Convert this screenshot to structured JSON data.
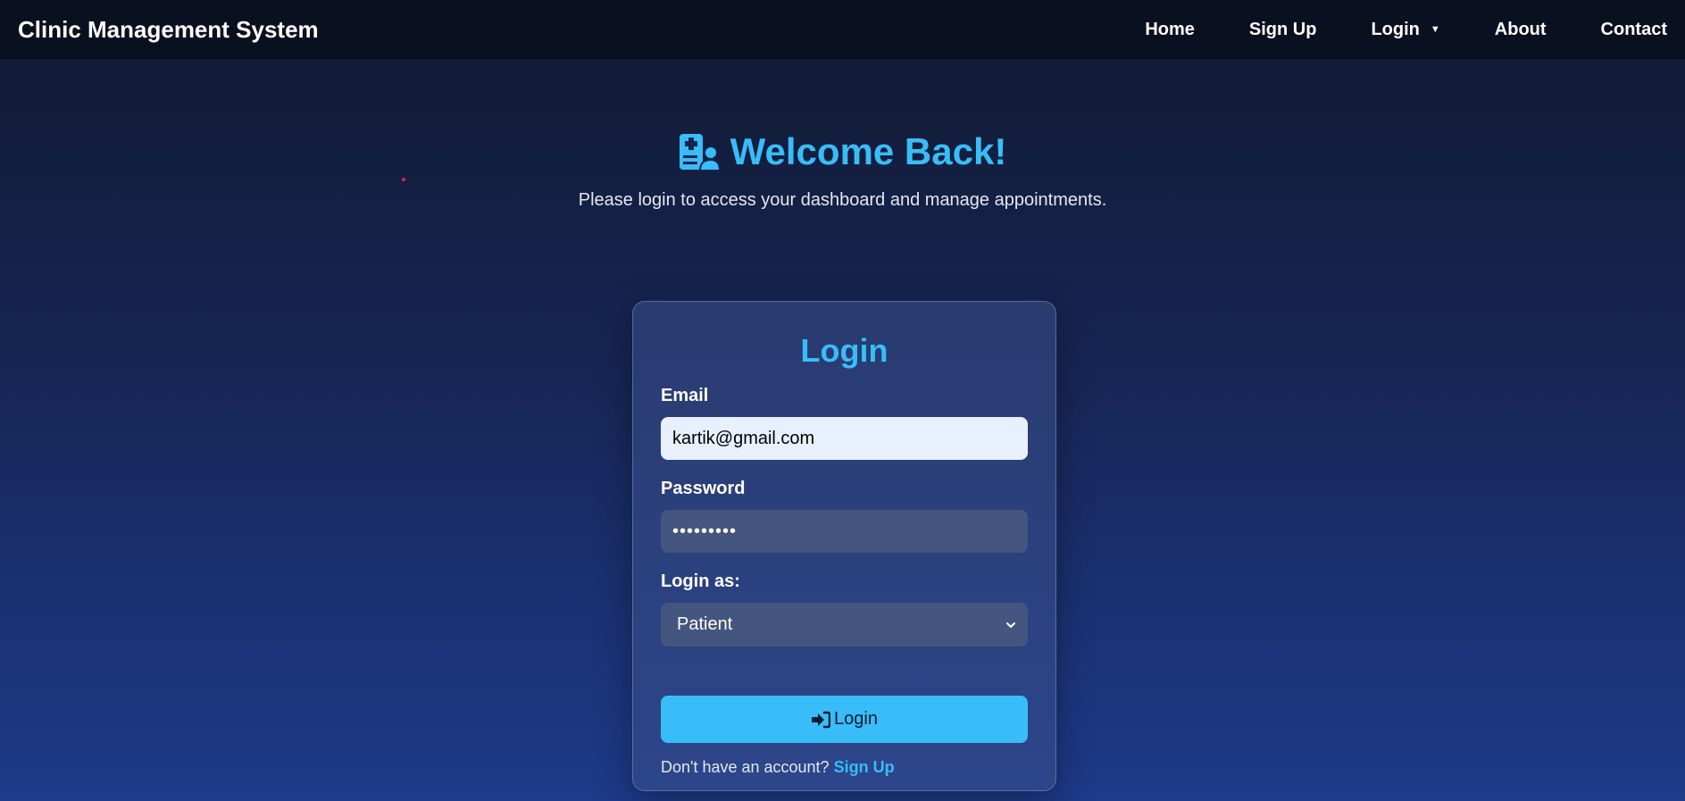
{
  "brand": "Clinic Management System",
  "nav": {
    "home": "Home",
    "signup": "Sign Up",
    "login": "Login",
    "login_caret": "▼",
    "about": "About",
    "contact": "Contact"
  },
  "hero": {
    "title": "Welcome Back!",
    "subtitle": "Please login to access your dashboard and manage appointments.",
    "icon": "clinic-user-icon"
  },
  "form": {
    "title": "Login",
    "email_label": "Email",
    "email_value": "kartik@gmail.com",
    "password_label": "Password",
    "password_value": "•••••••••",
    "role_label": "Login as:",
    "role_value": "Patient",
    "submit_label": "Login",
    "submit_icon": "sign-in-icon",
    "signup_prompt": "Don't have an account?",
    "signup_link": "Sign Up"
  },
  "colors": {
    "accent": "#38bdf8",
    "navbar_bg": "#0a1020",
    "input_bg": "#44557f"
  }
}
